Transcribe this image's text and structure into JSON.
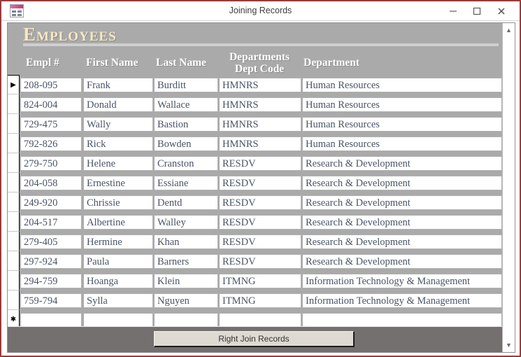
{
  "window": {
    "title": "Joining Records",
    "icon": "access-form-icon",
    "controls": {
      "minimize": "minimize-icon",
      "maximize": "maximize-icon",
      "close": "close-icon"
    },
    "border_color": "#9c3b3b"
  },
  "form": {
    "title": "Employees",
    "background_color": "#aaaaaa",
    "title_color": "#f6e8c4",
    "columns": [
      {
        "key": "empl",
        "label": "Empl #"
      },
      {
        "key": "first",
        "label": "First Name"
      },
      {
        "key": "last",
        "label": "Last Name"
      },
      {
        "key": "code",
        "label_line1": "Departments",
        "label_line2": "Dept Code"
      },
      {
        "key": "dept",
        "label": "Department"
      }
    ],
    "rows": [
      {
        "selector": "▶",
        "empl": "208-095",
        "first": "Frank",
        "last": "Burditt",
        "code": "HMNRS",
        "dept": "Human Resources"
      },
      {
        "selector": "",
        "empl": "824-004",
        "first": "Donald",
        "last": "Wallace",
        "code": "HMNRS",
        "dept": "Human Resources"
      },
      {
        "selector": "",
        "empl": "729-475",
        "first": "Wally",
        "last": "Bastion",
        "code": "HMNRS",
        "dept": "Human Resources"
      },
      {
        "selector": "",
        "empl": "792-826",
        "first": "Rick",
        "last": "Bowden",
        "code": "HMNRS",
        "dept": "Human Resources"
      },
      {
        "selector": "",
        "empl": "279-750",
        "first": "Helene",
        "last": "Cranston",
        "code": "RESDV",
        "dept": "Research & Development"
      },
      {
        "selector": "",
        "empl": "204-058",
        "first": "Ernestine",
        "last": "Essiane",
        "code": "RESDV",
        "dept": "Research & Development"
      },
      {
        "selector": "",
        "empl": "249-920",
        "first": "Chrissie",
        "last": "Dentd",
        "code": "RESDV",
        "dept": "Research & Development"
      },
      {
        "selector": "",
        "empl": "204-517",
        "first": "Albertine",
        "last": "Walley",
        "code": "RESDV",
        "dept": "Research & Development"
      },
      {
        "selector": "",
        "empl": "279-405",
        "first": "Hermine",
        "last": "Khan",
        "code": "RESDV",
        "dept": "Research & Development"
      },
      {
        "selector": "",
        "empl": "297-924",
        "first": "Paula",
        "last": "Barners",
        "code": "RESDV",
        "dept": "Research & Development"
      },
      {
        "selector": "",
        "empl": "294-759",
        "first": "Hoanga",
        "last": "Klein",
        "code": "ITMNG",
        "dept": "Information Technology & Management"
      },
      {
        "selector": "",
        "empl": "759-794",
        "first": "Sylla",
        "last": "Nguyen",
        "code": "ITMNG",
        "dept": "Information Technology & Management"
      },
      {
        "selector": "✱",
        "empl": "",
        "first": "",
        "last": "",
        "code": "",
        "dept": ""
      }
    ]
  },
  "footer": {
    "button_label": "Right Join Records"
  },
  "scrollbar": {
    "up_arrow": "scroll-up-icon",
    "down_arrow": "scroll-down-icon"
  }
}
